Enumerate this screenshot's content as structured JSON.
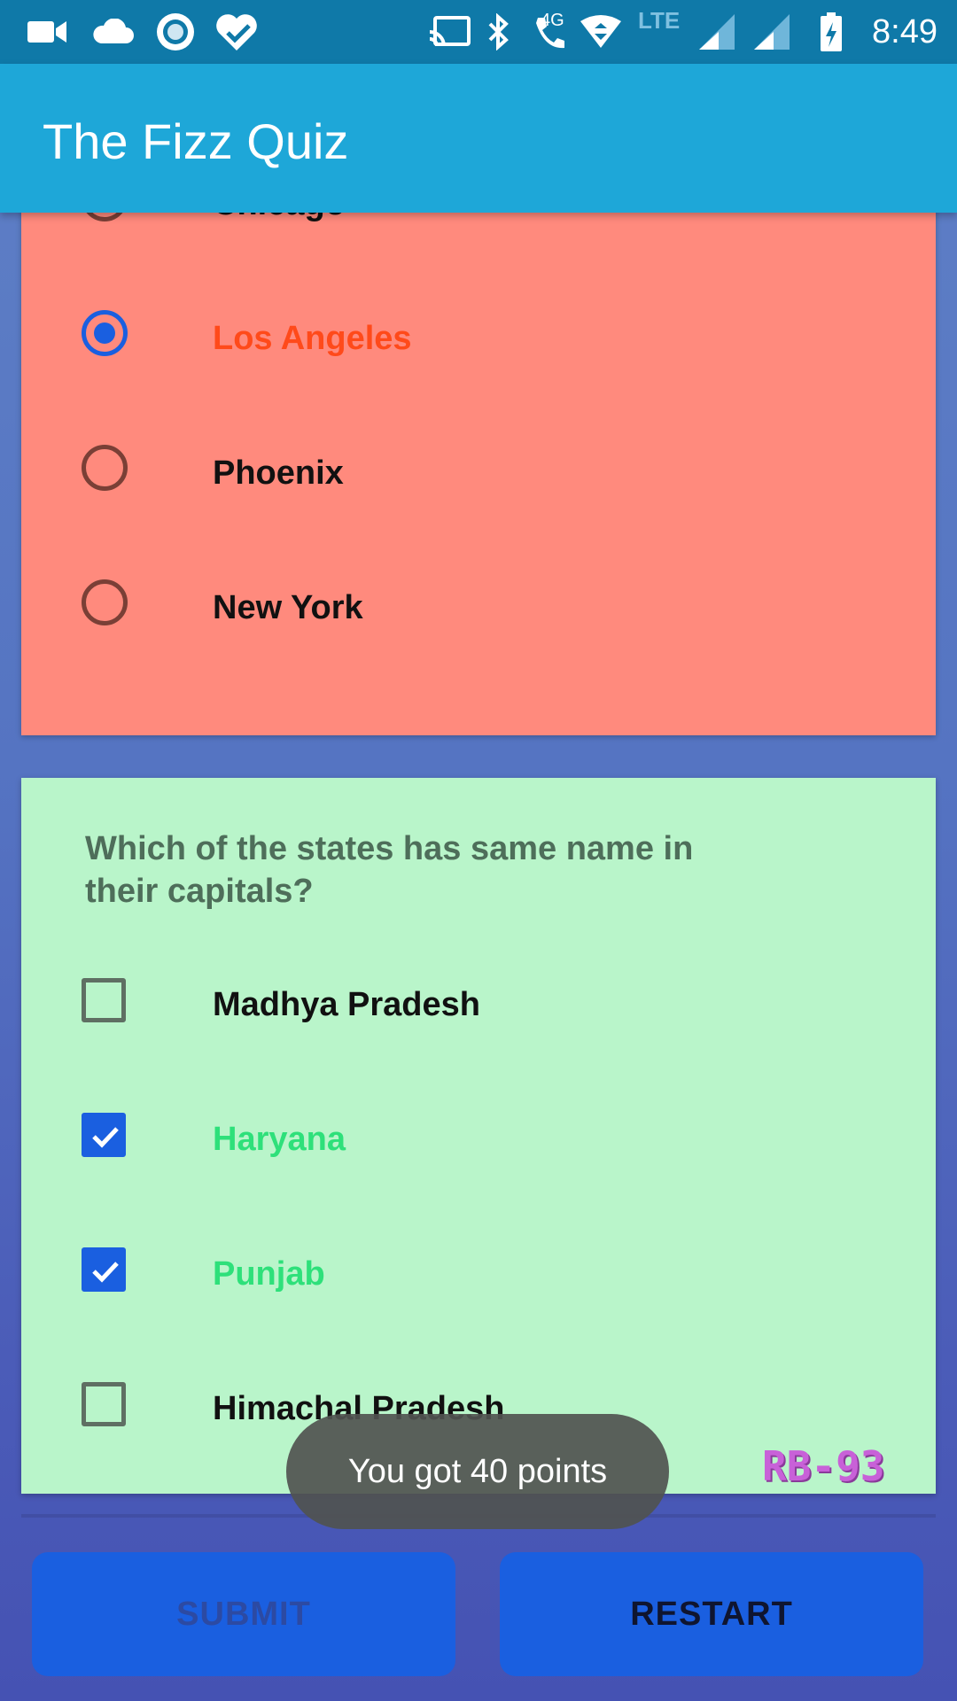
{
  "status_bar": {
    "time": "8:49",
    "network_label": "LTE",
    "call_label": "4G",
    "left_icons": [
      "video-camera-icon",
      "cloud-icon",
      "circle-target-icon",
      "heart-check-icon"
    ],
    "right_icons": [
      "cast-icon",
      "bluetooth-icon",
      "volte-call-icon",
      "wifi-icon",
      "signal-icon",
      "signal-icon",
      "battery-charging-icon"
    ]
  },
  "app_bar": {
    "title": "The Fizz Quiz"
  },
  "question1": {
    "options": [
      {
        "label": "Chicago",
        "selected": false
      },
      {
        "label": "Los Angeles",
        "selected": true
      },
      {
        "label": "Phoenix",
        "selected": false
      },
      {
        "label": "New York",
        "selected": false
      }
    ],
    "background_color": "#ff8a7d",
    "selected_text_color": "#ff4a1a"
  },
  "question2": {
    "text": "Which of the states has same name in their capitals?",
    "options": [
      {
        "label": "Madhya Pradesh",
        "checked": false
      },
      {
        "label": "Haryana",
        "checked": true
      },
      {
        "label": "Punjab",
        "checked": true
      },
      {
        "label": "Himachal Pradesh",
        "checked": false
      }
    ],
    "background_color": "#b9f5ca",
    "checked_text_color": "#2ee07a"
  },
  "toast": {
    "text": "You got 40 points"
  },
  "watermark": "RB-93",
  "buttons": {
    "submit_label": "SUBMIT",
    "restart_label": "RESTART"
  },
  "colors": {
    "status_bar": "#0f79a8",
    "app_bar": "#1ea7d8",
    "accent": "#1a5fe0"
  }
}
